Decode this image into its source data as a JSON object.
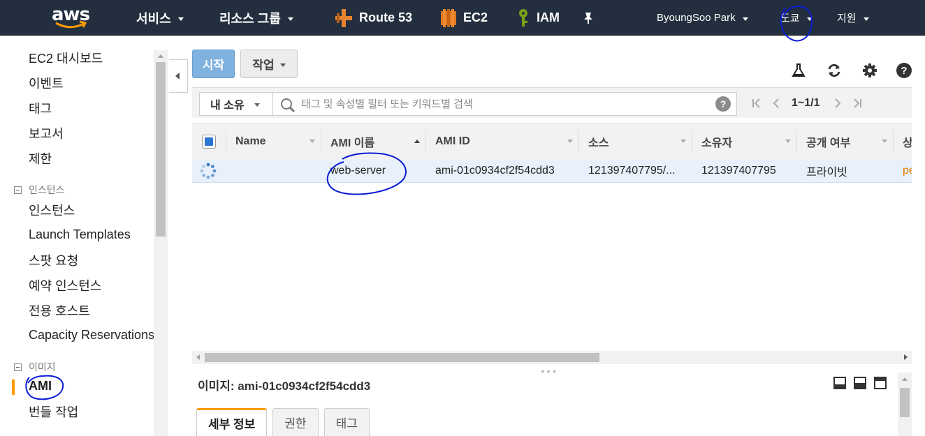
{
  "brand": {
    "logo_text": "aws"
  },
  "topnav": {
    "services_label": "서비스",
    "resource_groups_label": "리소스 그룹",
    "shortcuts": [
      {
        "label": "Route 53",
        "icon": "route53-icon"
      },
      {
        "label": "EC2",
        "icon": "ec2-icon"
      },
      {
        "label": "IAM",
        "icon": "iam-icon"
      }
    ],
    "pin_icon": "pin-icon",
    "user_label": "ByoungSoo Park",
    "region_label": "도쿄",
    "support_label": "지원"
  },
  "sidebar": {
    "items_top": [
      "EC2 대시보드",
      "이벤트",
      "태그",
      "보고서",
      "제한"
    ],
    "group_instances": "인스턴스",
    "items_instances": [
      "인스턴스",
      "Launch Templates",
      "스팟 요청",
      "예약 인스턴스",
      "전용 호스트",
      "Capacity Reservations"
    ],
    "group_images": "이미지",
    "items_images": [
      "AMI",
      "번들 작업"
    ],
    "active_item": "AMI"
  },
  "toolbar": {
    "start_label": "시작",
    "actions_label": "작업",
    "icons": [
      "flask-icon",
      "refresh-icon",
      "gear-icon",
      "help-icon"
    ]
  },
  "filter": {
    "owner_label": "내 소유",
    "search_placeholder": "태그 및 속성별 필터 또는 키워드별 검색",
    "pagination": "1~1/1"
  },
  "table": {
    "columns": [
      "Name",
      "AMI 이름",
      "AMI ID",
      "소스",
      "소유자",
      "공개 여부",
      "상"
    ],
    "rows": [
      {
        "name": "",
        "ami_name": "web-server",
        "ami_id": "ami-01c0934cf2f54cdd3",
        "source": "121397407795/...",
        "owner": "121397407795",
        "visibility": "프라이빗",
        "status": "pe"
      }
    ]
  },
  "detail": {
    "title": "이미지: ami-01c0934cf2f54cdd3",
    "tabs": [
      "세부 정보",
      "권한",
      "태그"
    ],
    "active_tab": "세부 정보"
  },
  "colors": {
    "nav_bg": "#232f3e",
    "accent_orange": "#ff9900",
    "start_button": "#7fb2de",
    "selected_row": "#e8f1fb",
    "status_pending": "#e07b00",
    "annotation_ink": "#0a1bd6"
  }
}
